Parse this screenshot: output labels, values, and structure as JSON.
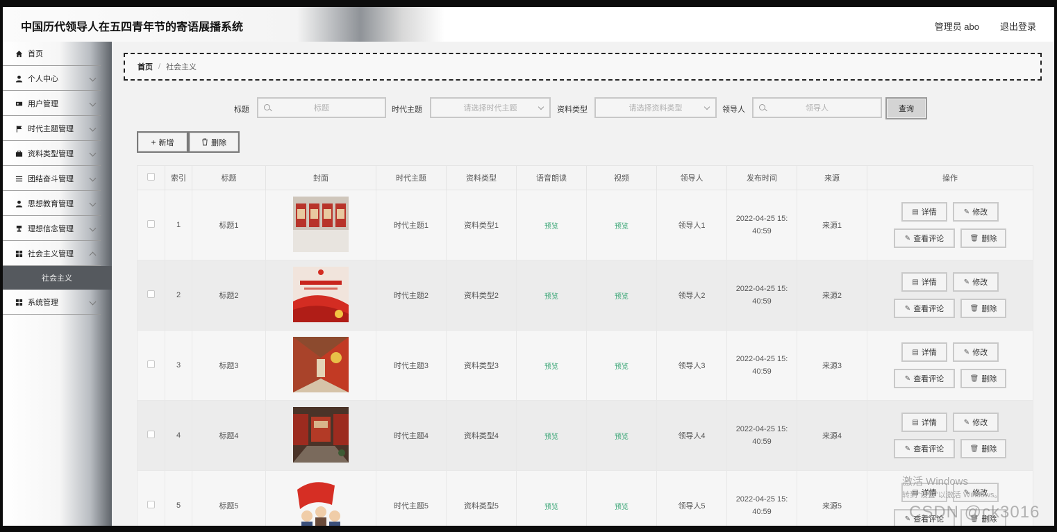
{
  "header": {
    "title": "中国历代领导人在五四青年节的寄语展播系统",
    "admin": "管理员 abo",
    "logout": "退出登录"
  },
  "sidebar": {
    "items": [
      {
        "label": "首页",
        "icon": "home-icon"
      },
      {
        "label": "个人中心",
        "icon": "user-icon"
      },
      {
        "label": "用户管理",
        "icon": "users-icon"
      },
      {
        "label": "时代主题管理",
        "icon": "flag-icon"
      },
      {
        "label": "资料类型管理",
        "icon": "briefcase-icon"
      },
      {
        "label": "团结奋斗管理",
        "icon": "list-icon"
      },
      {
        "label": "思想教育管理",
        "icon": "user-icon"
      },
      {
        "label": "理想信念管理",
        "icon": "trophy-icon"
      },
      {
        "label": "社会主义管理",
        "icon": "grid-icon"
      },
      {
        "label": "系统管理",
        "icon": "grid-icon"
      }
    ],
    "active_sub": "社会主义"
  },
  "breadcrumb": {
    "home": "首页",
    "sep": "/",
    "current": "社会主义"
  },
  "search": {
    "title_label": "标题",
    "title_placeholder": "标题",
    "theme_label": "时代主题",
    "theme_placeholder": "请选择时代主题",
    "type_label": "资料类型",
    "type_placeholder": "请选择资料类型",
    "leader_label": "领导人",
    "leader_placeholder": "领导人",
    "query": "查询"
  },
  "actions": {
    "add": "新增",
    "delete": "删除"
  },
  "table": {
    "headers": [
      "",
      "索引",
      "标题",
      "封面",
      "时代主题",
      "资料类型",
      "语音朗读",
      "视频",
      "领导人",
      "发布时间",
      "来源",
      "操作"
    ],
    "rows": [
      {
        "index": "1",
        "title": "标题1",
        "theme": "时代主题1",
        "type": "资料类型1",
        "audio": "预览",
        "video": "预览",
        "leader": "领导人1",
        "time1": "2022-04-25 15:",
        "time2": "40:59",
        "source": "来源1"
      },
      {
        "index": "2",
        "title": "标题2",
        "theme": "时代主题2",
        "type": "资料类型2",
        "audio": "预览",
        "video": "预览",
        "leader": "领导人2",
        "time1": "2022-04-25 15:",
        "time2": "40:59",
        "source": "来源2"
      },
      {
        "index": "3",
        "title": "标题3",
        "theme": "时代主题3",
        "type": "资料类型3",
        "audio": "预览",
        "video": "预览",
        "leader": "领导人3",
        "time1": "2022-04-25 15:",
        "time2": "40:59",
        "source": "来源3"
      },
      {
        "index": "4",
        "title": "标题4",
        "theme": "时代主题4",
        "type": "资料类型4",
        "audio": "预览",
        "video": "预览",
        "leader": "领导人4",
        "time1": "2022-04-25 15:",
        "time2": "40:59",
        "source": "来源4"
      },
      {
        "index": "5",
        "title": "标题5",
        "theme": "时代主题5",
        "type": "资料类型5",
        "audio": "预览",
        "video": "预览",
        "leader": "领导人5",
        "time1": "2022-04-25 15:",
        "time2": "40:59",
        "source": "来源5"
      }
    ],
    "ops": {
      "detail": "详情",
      "edit": "修改",
      "comments": "查看评论",
      "delete": "删除"
    }
  },
  "watermark": {
    "line1": "激活 Windows",
    "line2": "转到\"设置\"以激活 Windows。",
    "line3": "CSDN @ck3016"
  },
  "colors": {
    "preview_link": "#3aa676",
    "submenu_active": "#55595e"
  }
}
